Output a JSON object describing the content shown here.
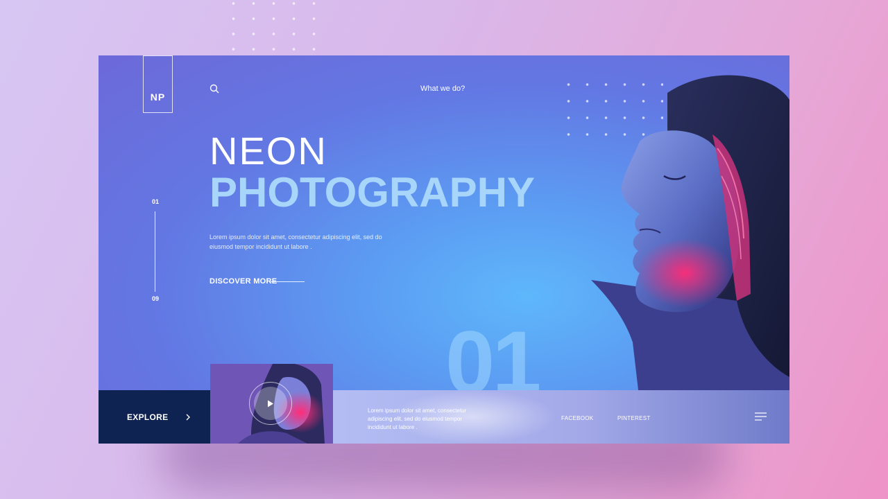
{
  "brand": {
    "logo_text": "NP"
  },
  "header": {
    "search_icon": "search-icon",
    "nav_link": "What we do?"
  },
  "slider": {
    "current": "01",
    "total": "09"
  },
  "hero": {
    "title_line1": "NEON",
    "title_line2": "PHOTOGRAPHY",
    "description": "Lorem ipsum dolor sit amet, consectetur adipiscing elit, sed do eiusmod tempor incididunt ut labore .",
    "cta_label": "DISCOVER MORE",
    "slide_number": "01"
  },
  "footer": {
    "explore_label": "EXPLORE",
    "explore_icon": "chevron-right-icon",
    "play_icon": "play-icon",
    "description": "Lorem ipsum dolor sit amet, consectetur adipiscing elit, sed do eiusmod tempor incididunt ut labore .",
    "social": [
      "FACEBOOK",
      "PINTEREST"
    ],
    "menu_icon": "hamburger-menu-icon"
  },
  "colors": {
    "accent_dark": "#0f2352",
    "title_light_blue": "#a8d6fb",
    "neon_pink": "#ff2d78",
    "background_gradient_start": "#d7c6f3",
    "background_gradient_end": "#ee93c7"
  }
}
